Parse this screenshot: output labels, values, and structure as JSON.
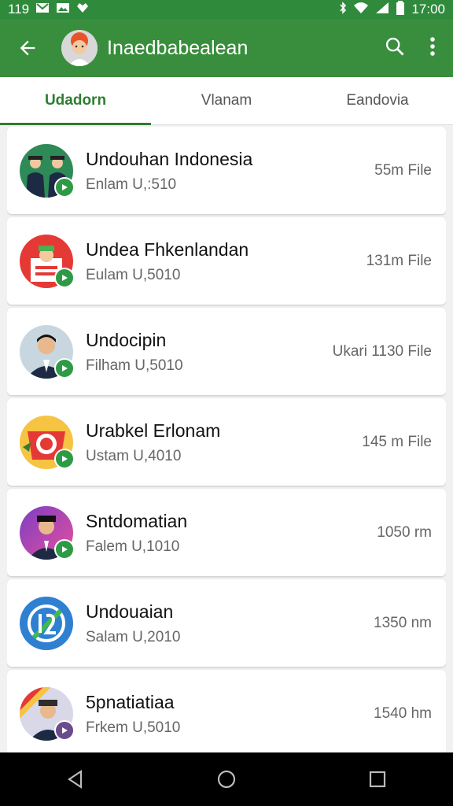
{
  "status_bar": {
    "time_left": "119",
    "time_right": "17:00"
  },
  "app_bar": {
    "title": "Inaedbabealean"
  },
  "tabs": [
    {
      "label": "Udadorn",
      "active": true
    },
    {
      "label": "Vlanam",
      "active": false
    },
    {
      "label": "Eandovia",
      "active": false
    }
  ],
  "items": [
    {
      "title": "Undouhan Indonesia",
      "subtitle": "Enlam U,:510",
      "size": "55m File",
      "thumb_color": "#2e8b57",
      "play_color": "#2e9a46"
    },
    {
      "title": "Undea Fhkenlandan",
      "subtitle": "Eulam U,5010",
      "size": "131m File",
      "thumb_color": "#e53935",
      "play_color": "#2e9a46"
    },
    {
      "title": "Undocipin",
      "subtitle": "Filham U,5010",
      "size": "Ukari 1130 File",
      "thumb_color": "#c8d6e0",
      "play_color": "#2e9a46"
    },
    {
      "title": "Urabkel Erlonam",
      "subtitle": "Ustam U,4010",
      "size": "145 m File",
      "thumb_color": "#f6c343",
      "play_color": "#2e9a46"
    },
    {
      "title": "Sntdomatian",
      "subtitle": "Falem U,1010",
      "size": "1050 rm",
      "thumb_color": "#b04fc8",
      "play_color": "#2e9a46"
    },
    {
      "title": "Undouaian",
      "subtitle": "Salam U,2010",
      "size": "1350 nm",
      "thumb_color": "#2f80d0",
      "play_color": "#2e9a46"
    },
    {
      "title": "5pnatiatiaa",
      "subtitle": "Frkem U,5010",
      "size": "1540 hm",
      "thumb_color": "#d8d8e8",
      "play_color": "#6a4b8c"
    }
  ]
}
